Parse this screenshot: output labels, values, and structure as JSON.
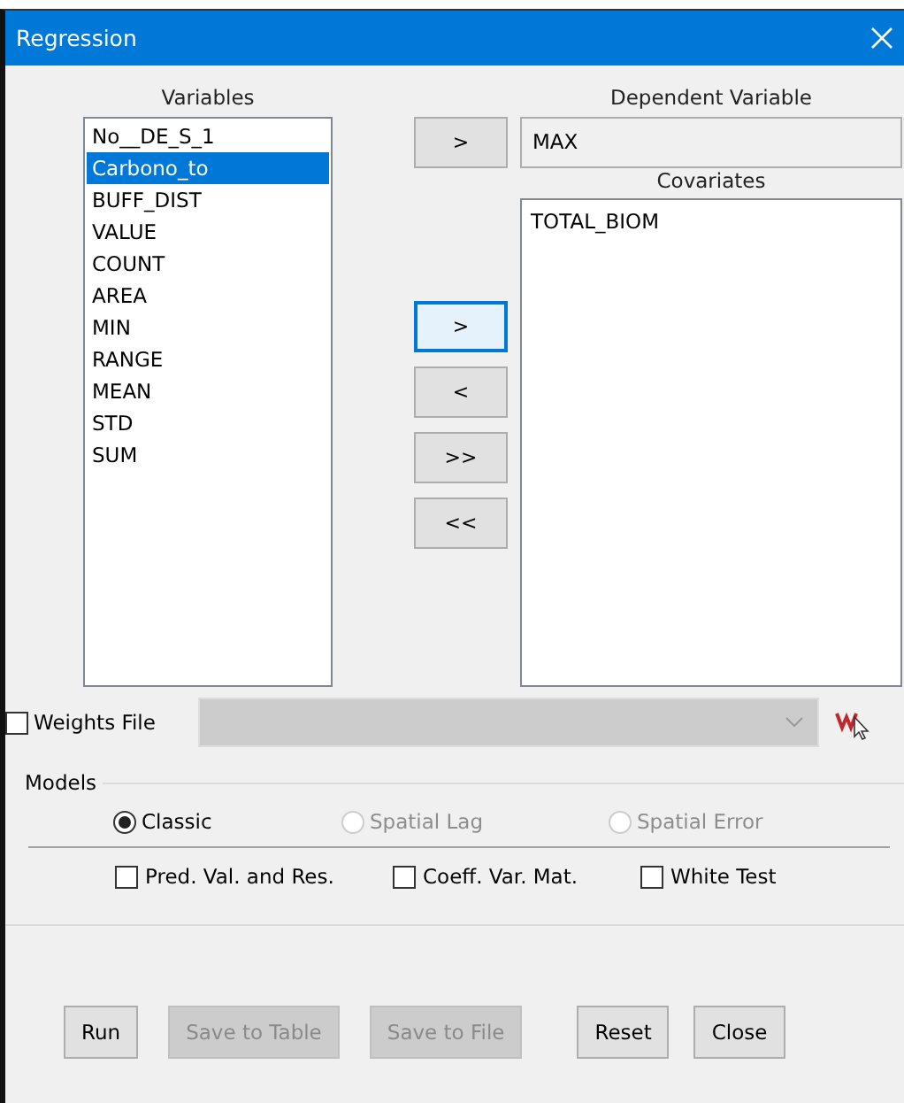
{
  "window": {
    "title": "Regression"
  },
  "variables": {
    "label": "Variables",
    "items": [
      {
        "text": "No__DE_S_1",
        "selected": false
      },
      {
        "text": "Carbono_to",
        "selected": true
      },
      {
        "text": "BUFF_DIST",
        "selected": false
      },
      {
        "text": "VALUE",
        "selected": false
      },
      {
        "text": "COUNT",
        "selected": false
      },
      {
        "text": "AREA",
        "selected": false
      },
      {
        "text": "MIN",
        "selected": false
      },
      {
        "text": "RANGE",
        "selected": false
      },
      {
        "text": "MEAN",
        "selected": false
      },
      {
        "text": "STD",
        "selected": false
      },
      {
        "text": "SUM",
        "selected": false
      }
    ]
  },
  "dependent": {
    "label": "Dependent Variable",
    "button": ">",
    "value": "MAX"
  },
  "covariates": {
    "label": "Covariates",
    "items": [
      "TOTAL_BIOM"
    ]
  },
  "move_buttons": [
    {
      "label": ">",
      "focused": true
    },
    {
      "label": "<",
      "focused": false
    },
    {
      "label": ">>",
      "focused": false
    },
    {
      "label": "<<",
      "focused": false
    }
  ],
  "weights": {
    "label": "Weights File",
    "checked": false,
    "dropdown_disabled": true
  },
  "models": {
    "label": "Models",
    "options": [
      {
        "label": "Classic",
        "selected": true,
        "disabled": false
      },
      {
        "label": "Spatial Lag",
        "selected": false,
        "disabled": true
      },
      {
        "label": "Spatial Error",
        "selected": false,
        "disabled": true
      }
    ],
    "checks": [
      {
        "label": "Pred. Val. and Res.",
        "checked": false
      },
      {
        "label": "Coeff. Var. Mat.",
        "checked": false
      },
      {
        "label": "White Test",
        "checked": false
      }
    ]
  },
  "buttons": [
    {
      "label": "Run",
      "disabled": false
    },
    {
      "label": "Save to Table",
      "disabled": true
    },
    {
      "label": "Save to File",
      "disabled": true
    },
    {
      "label": "Reset",
      "disabled": false
    },
    {
      "label": "Close",
      "disabled": false
    }
  ]
}
